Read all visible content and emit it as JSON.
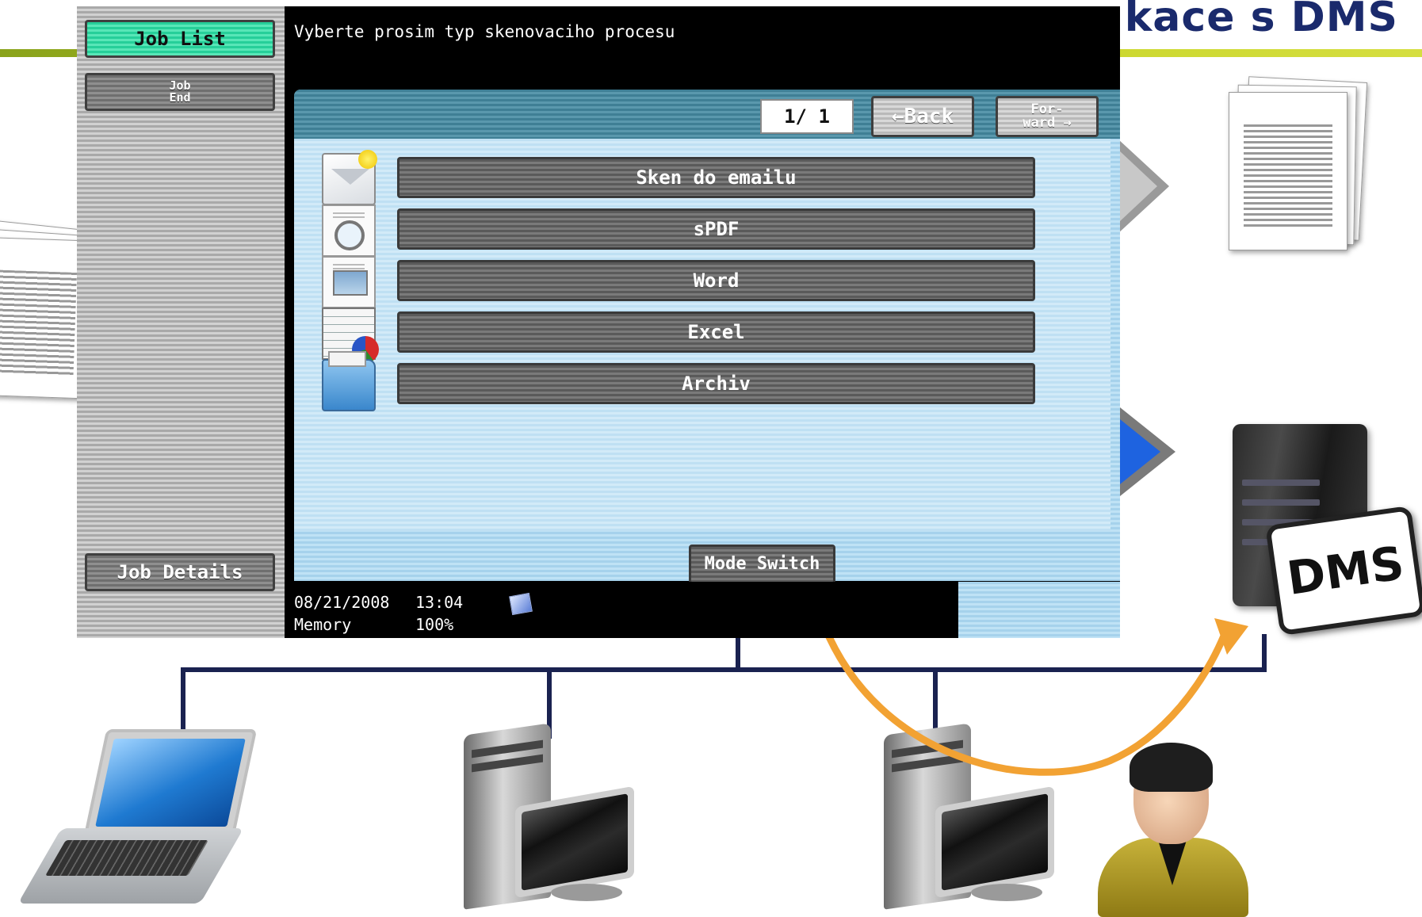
{
  "slide": {
    "title": "kace s DMS",
    "server_label": "DMS"
  },
  "device": {
    "sidebar": {
      "job_list": "Job List",
      "job_end_line1": "Job",
      "job_end_line2": "End",
      "job_details": "Job Details"
    },
    "header_message": "Vyberte prosim typ skenovaciho procesu",
    "pagination": {
      "indicator": "1/  1",
      "back_label": "←Back",
      "forward_line1": "For-",
      "forward_line2": "ward →"
    },
    "options": [
      {
        "label": "Sken do emailu",
        "icon": "mail-icon"
      },
      {
        "label": "sPDF",
        "icon": "pdf-search-icon"
      },
      {
        "label": "Word",
        "icon": "word-doc-icon"
      },
      {
        "label": "Excel",
        "icon": "excel-chart-icon"
      },
      {
        "label": "Archiv",
        "icon": "folder-icon"
      }
    ],
    "mode_switch": "Mode Switch",
    "status": {
      "date": "08/21/2008",
      "time": "13:04",
      "memory_label": "Memory",
      "memory_value": "100%"
    }
  },
  "colors": {
    "title": "#1a2a6c",
    "accent_rule": "#8aa31b",
    "active_button": "#26cf99",
    "panel_blue": "#a6d2ec",
    "network_line": "#1a2250",
    "flow_arrow": "#f2a233"
  }
}
